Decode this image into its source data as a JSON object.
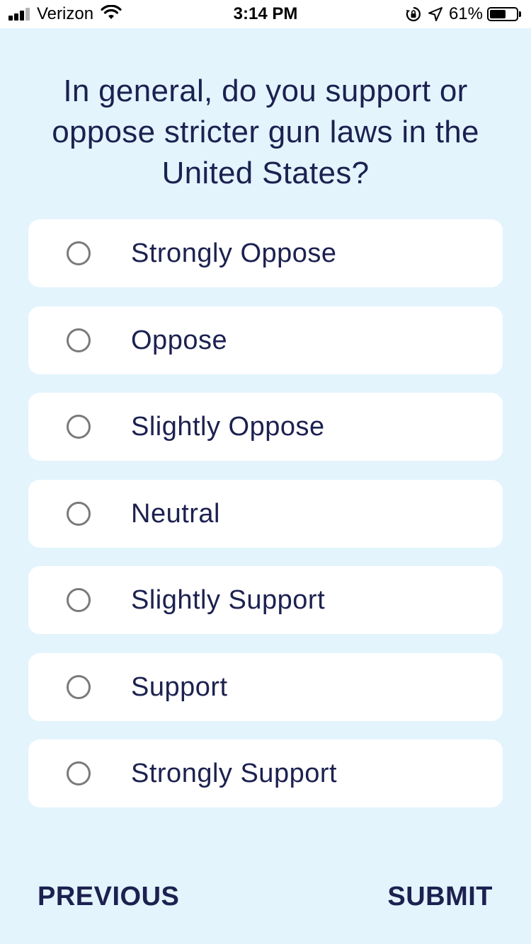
{
  "status_bar": {
    "carrier": "Verizon",
    "time": "3:14 PM",
    "battery_percent": "61%",
    "battery_level": 0.61,
    "signal_bars_active": 3,
    "signal_bars_total": 4,
    "icons": [
      "wifi-icon",
      "orientation-lock-icon",
      "location-arrow-icon",
      "battery-icon"
    ]
  },
  "question": {
    "text": "In general, do you support or oppose stricter gun laws in the United States?"
  },
  "options": [
    {
      "label": "Strongly Oppose",
      "selected": false
    },
    {
      "label": "Oppose",
      "selected": false
    },
    {
      "label": "Slightly Oppose",
      "selected": false
    },
    {
      "label": "Neutral",
      "selected": false
    },
    {
      "label": "Slightly Support",
      "selected": false
    },
    {
      "label": "Support",
      "selected": false
    },
    {
      "label": "Strongly Support",
      "selected": false
    }
  ],
  "footer": {
    "previous_label": "PREVIOUS",
    "submit_label": "SUBMIT"
  },
  "colors": {
    "background": "#e3f4fd",
    "card": "#ffffff",
    "text": "#1c2150",
    "radio_border": "#7a7a7a"
  }
}
